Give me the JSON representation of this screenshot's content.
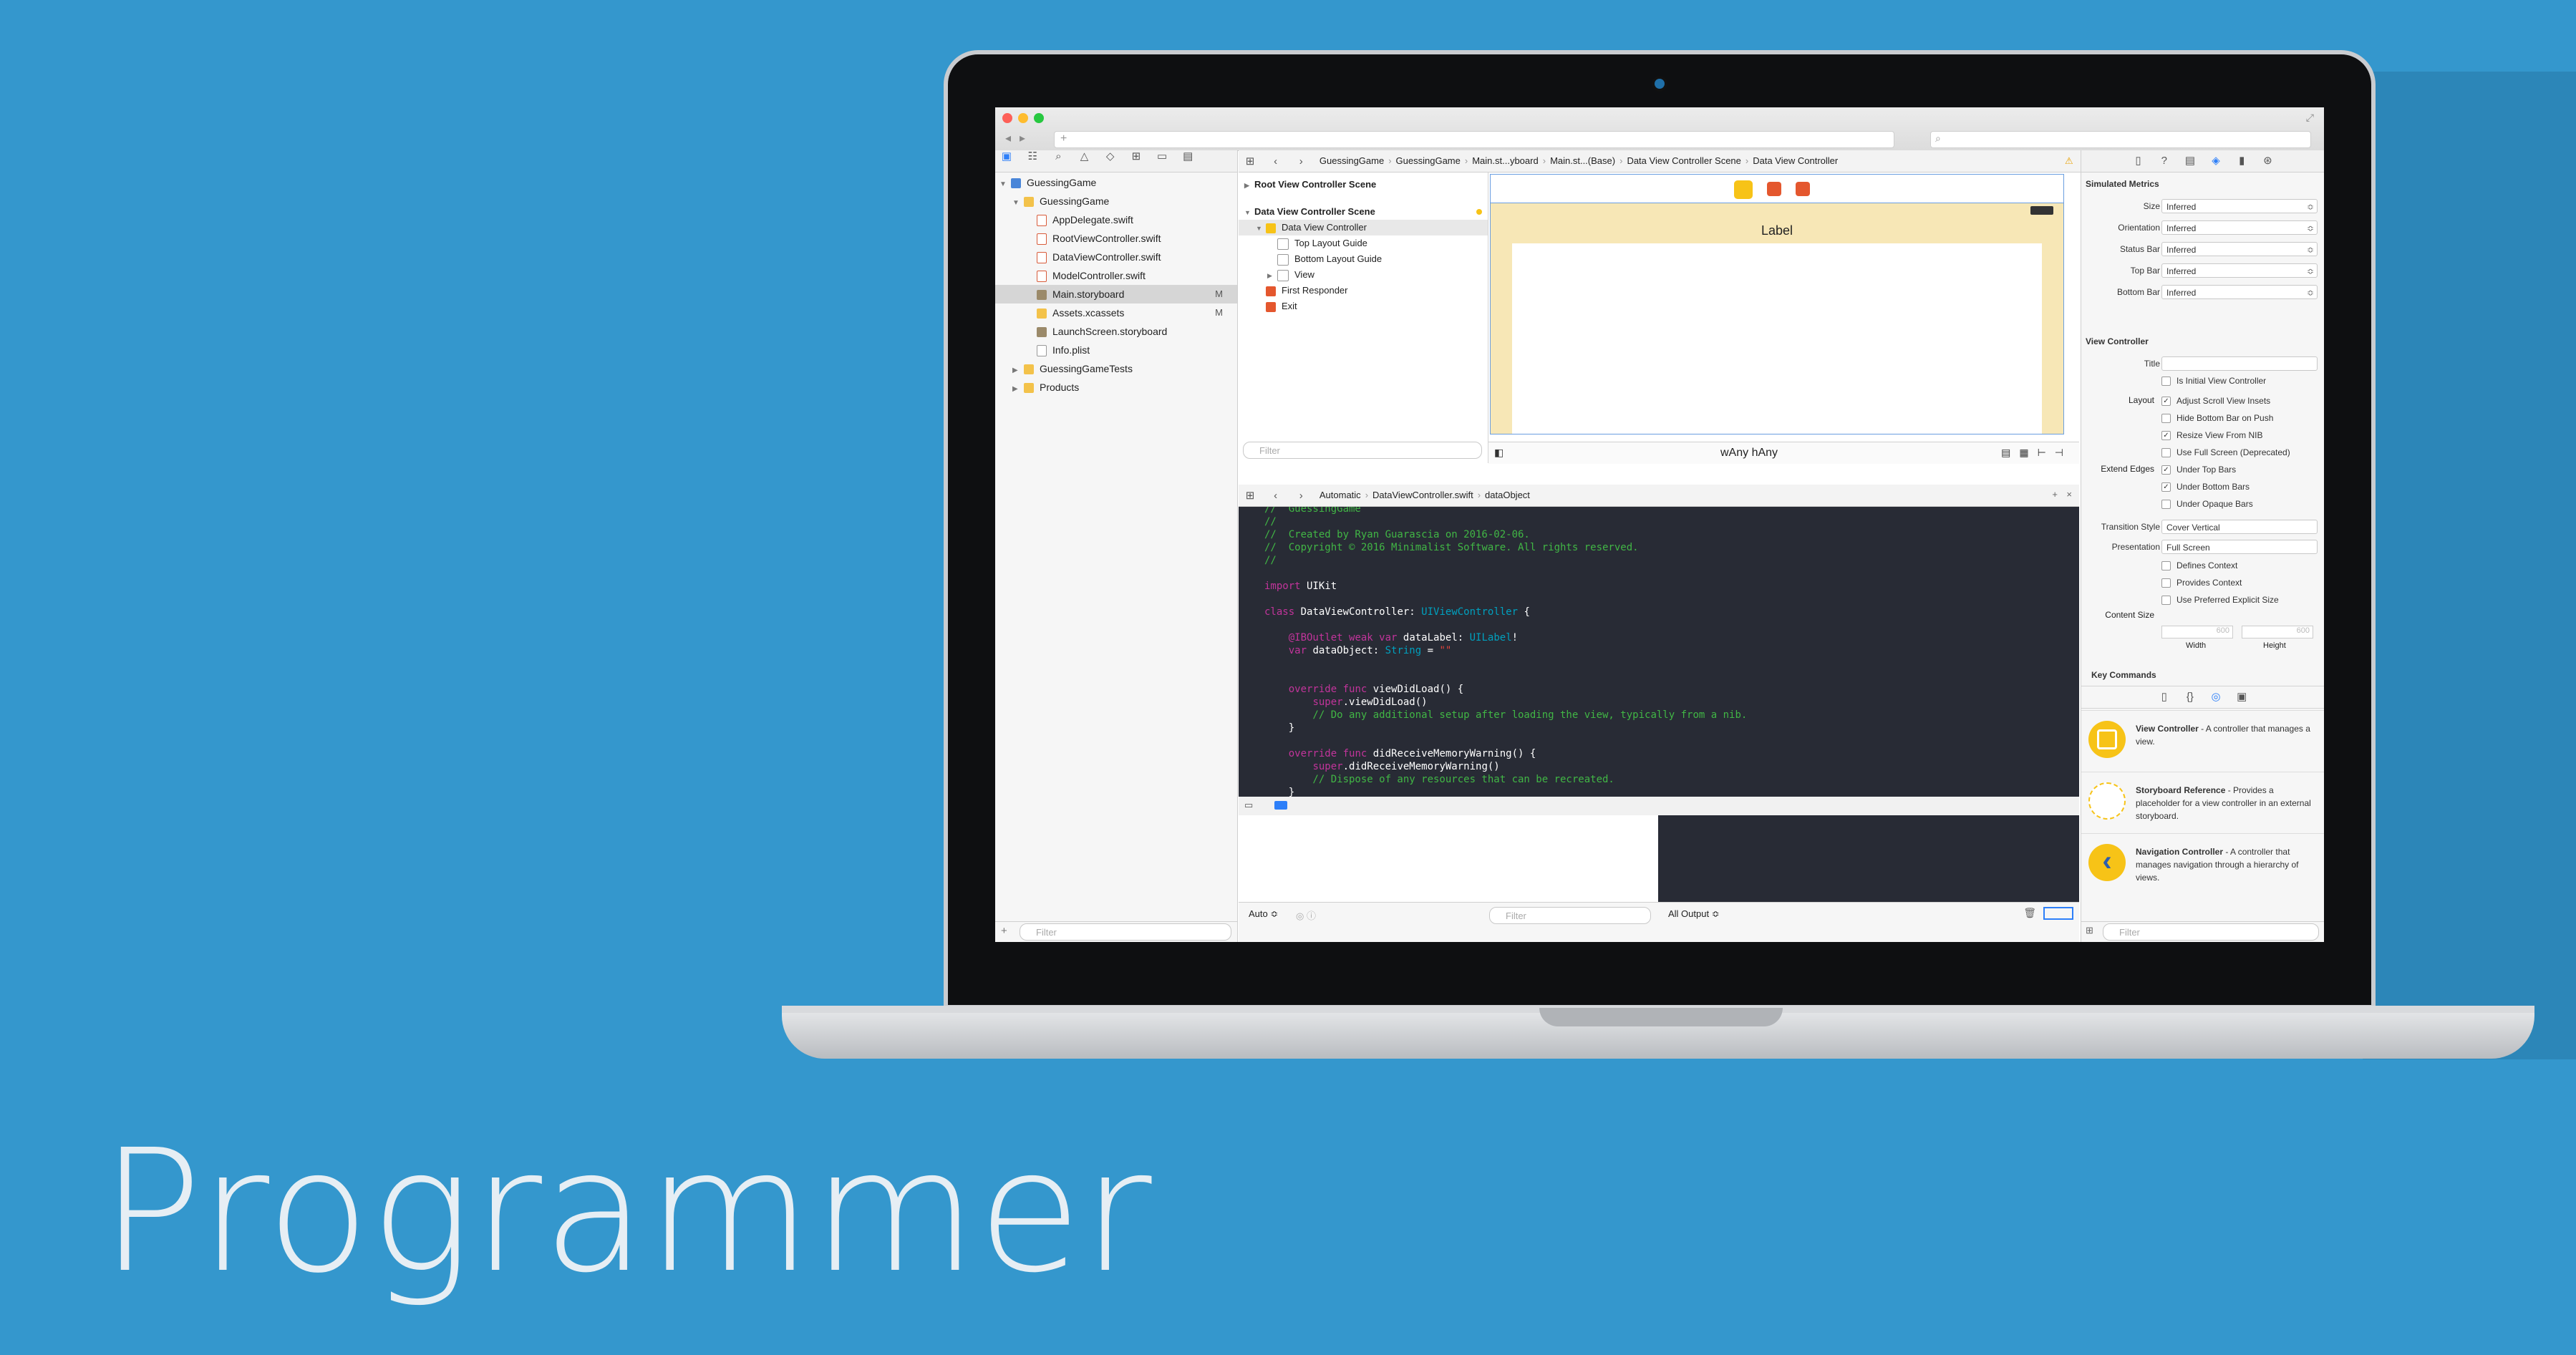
{
  "headline": "Programmer",
  "colors": {
    "background": "#3497cd",
    "accent": "#f7c317",
    "editor_bg": "#282b35"
  },
  "navigator": {
    "items": [
      {
        "label": "GuessingGame",
        "icon": "project-icon",
        "depth": 0
      },
      {
        "label": "GuessingGame",
        "icon": "folder-icon",
        "depth": 1
      },
      {
        "label": "AppDelegate.swift",
        "icon": "swift-file-icon",
        "depth": 2
      },
      {
        "label": "RootViewController.swift",
        "icon": "swift-file-icon",
        "depth": 2
      },
      {
        "label": "DataViewController.swift",
        "icon": "swift-file-icon",
        "depth": 2
      },
      {
        "label": "ModelController.swift",
        "icon": "swift-file-icon",
        "depth": 2
      },
      {
        "label": "Main.storyboard",
        "icon": "storyboard-icon",
        "depth": 2,
        "badge": "M",
        "selected": true
      },
      {
        "label": "Assets.xcassets",
        "icon": "folder-icon",
        "depth": 2,
        "badge": "M"
      },
      {
        "label": "LaunchScreen.storyboard",
        "icon": "storyboard-icon",
        "depth": 2
      },
      {
        "label": "Info.plist",
        "icon": "file-icon",
        "depth": 2
      },
      {
        "label": "GuessingGameTests",
        "icon": "folder-icon",
        "depth": 1
      },
      {
        "label": "Products",
        "icon": "folder-icon",
        "depth": 1
      }
    ],
    "filter_placeholder": "Filter"
  },
  "jumpbar": {
    "crumbs": [
      "GuessingGame",
      "GuessingGame",
      "Main.st...yboard",
      "Main.st...(Base)",
      "Data View Controller Scene",
      "Data View Controller"
    ]
  },
  "outline": {
    "items": [
      {
        "label": "Root View Controller Scene",
        "bold": true
      },
      {
        "label": "Data View Controller Scene",
        "bold": true
      },
      {
        "label": "Data View Controller"
      },
      {
        "label": "Top Layout Guide"
      },
      {
        "label": "Bottom Layout Guide"
      },
      {
        "label": "View"
      },
      {
        "label": "First Responder"
      },
      {
        "label": "Exit"
      }
    ],
    "filter_placeholder": "Filter"
  },
  "canvas": {
    "label_text": "Label",
    "size_class": "wAny hAny"
  },
  "editor_jumpbar": {
    "crumbs": [
      "Automatic",
      "DataViewController.swift",
      "dataObject"
    ]
  },
  "code_lines": [
    "//  GuessingGame",
    "//",
    "//  Created by Ryan Guarascia on 2016-02-06.",
    "//  Copyright © 2016 Minimalist Software. All rights reserved.",
    "//",
    "",
    "import UIKit",
    "",
    "class DataViewController: UIViewController {",
    "",
    "    @IBOutlet weak var dataLabel: UILabel!",
    "    var dataObject: String = \"\"",
    "",
    "",
    "    override func viewDidLoad() {",
    "        super.viewDidLoad()",
    "        // Do any additional setup after loading the view, typically from a nib.",
    "    }",
    "",
    "    override func didReceiveMemoryWarning() {",
    "        super.didReceiveMemoryWarning()",
    "        // Dispose of any resources that can be recreated.",
    "    }"
  ],
  "debug": {
    "auto_label": "Auto ≎",
    "filter_placeholder": "Filter",
    "output_label": "All Output ≎"
  },
  "inspector": {
    "simulated_metrics": {
      "title": "Simulated Metrics",
      "rows": [
        {
          "key": "Size",
          "value": "Inferred"
        },
        {
          "key": "Orientation",
          "value": "Inferred"
        },
        {
          "key": "Status Bar",
          "value": "Inferred"
        },
        {
          "key": "Top Bar",
          "value": "Inferred"
        },
        {
          "key": "Bottom Bar",
          "value": "Inferred"
        }
      ]
    },
    "view_controller": {
      "title": "View Controller",
      "title_label": "Title",
      "is_initial": "Is Initial View Controller",
      "layout_label": "Layout",
      "layout_options": [
        {
          "label": "Adjust Scroll View Insets",
          "checked": true
        },
        {
          "label": "Hide Bottom Bar on Push",
          "checked": false
        },
        {
          "label": "Resize View From NIB",
          "checked": true
        },
        {
          "label": "Use Full Screen (Deprecated)",
          "checked": false
        }
      ],
      "extend_label": "Extend Edges",
      "extend_options": [
        {
          "label": "Under Top Bars",
          "checked": true
        },
        {
          "label": "Under Bottom Bars",
          "checked": true
        },
        {
          "label": "Under Opaque Bars",
          "checked": false
        }
      ],
      "transition_label": "Transition Style",
      "transition_value": "Cover Vertical",
      "presentation_label": "Presentation",
      "presentation_value": "Full Screen",
      "context_options": [
        {
          "label": "Defines Context",
          "checked": false
        },
        {
          "label": "Provides Context",
          "checked": false
        },
        {
          "label": "Use Preferred Explicit Size",
          "checked": false
        }
      ],
      "content_size_label": "Content Size",
      "width_value": "600",
      "height_value": "600",
      "width_label": "Width",
      "height_label": "Height"
    },
    "key_commands": "Key Commands",
    "library": [
      {
        "name": "View Controller",
        "desc": " - A controller that manages a view.",
        "icon": "view-controller-icon"
      },
      {
        "name": "Storyboard Reference",
        "desc": " - Provides a placeholder for a view controller in an external storyboard.",
        "icon": "storyboard-reference-icon"
      },
      {
        "name": "Navigation Controller",
        "desc": " - A controller that manages navigation through a hierarchy of views.",
        "icon": "navigation-controller-icon"
      }
    ],
    "filter_placeholder": "Filter"
  }
}
